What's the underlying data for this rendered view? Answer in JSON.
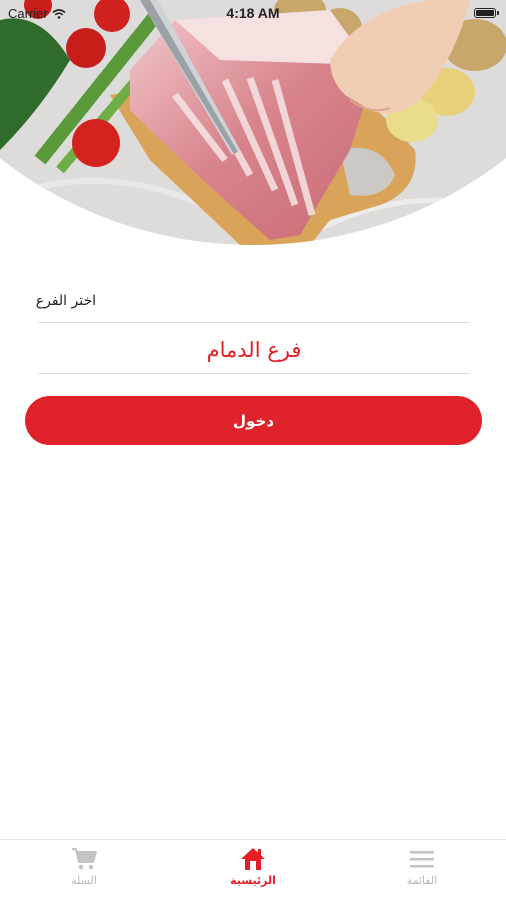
{
  "status_bar": {
    "carrier": "Carrier",
    "time": "4:18 AM"
  },
  "branch": {
    "label": "اختر الفرع",
    "selected": "فرع الدمام"
  },
  "enter_button": {
    "label": "دخول"
  },
  "tabs": [
    {
      "id": "cart",
      "label": "السلة",
      "icon": "cart-icon",
      "active": false
    },
    {
      "id": "home",
      "label": "الرئيسية",
      "icon": "home-icon",
      "active": true
    },
    {
      "id": "menu",
      "label": "القائمة",
      "icon": "menu-icon",
      "active": false
    }
  ],
  "colors": {
    "accent": "#e0232b",
    "inactive_tab": "#b8b8b8"
  }
}
